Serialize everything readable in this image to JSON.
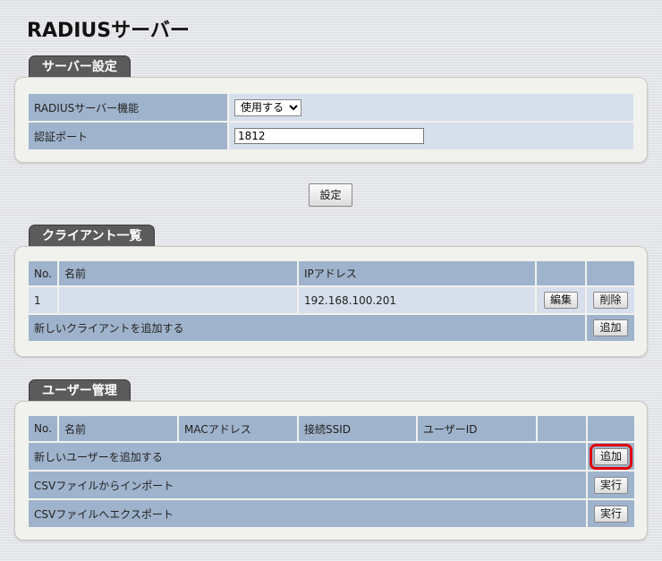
{
  "page": {
    "title": "RADIUSサーバー"
  },
  "server_settings": {
    "tab": "サーバー設定",
    "function_label": "RADIUSサーバー機能",
    "function_value": "使用する",
    "function_options": [
      "使用する"
    ],
    "port_label": "認証ポート",
    "port_value": "1812"
  },
  "set_button": "設定",
  "clients": {
    "tab": "クライアント一覧",
    "headers": {
      "no": "No.",
      "name": "名前",
      "ip": "IPアドレス"
    },
    "rows": [
      {
        "no": "1",
        "name": "",
        "ip": "192.168.100.201",
        "edit": "編集",
        "delete": "削除"
      }
    ],
    "add_label": "新しいクライアントを追加する",
    "add_button": "追加"
  },
  "users": {
    "tab": "ユーザー管理",
    "headers": {
      "no": "No.",
      "name": "名前",
      "mac": "MACアドレス",
      "ssid": "接続SSID",
      "user_id": "ユーザーID"
    },
    "add_label": "新しいユーザーを追加する",
    "add_button": "追加",
    "import_label": "CSVファイルからインポート",
    "import_button": "実行",
    "export_label": "CSVファイルへエクスポート",
    "export_button": "実行"
  },
  "colors": {
    "tab": "#5b5b5b",
    "label_cell": "#9fb3cc",
    "value_cell": "#d7dfec",
    "highlight": "#e00000"
  }
}
